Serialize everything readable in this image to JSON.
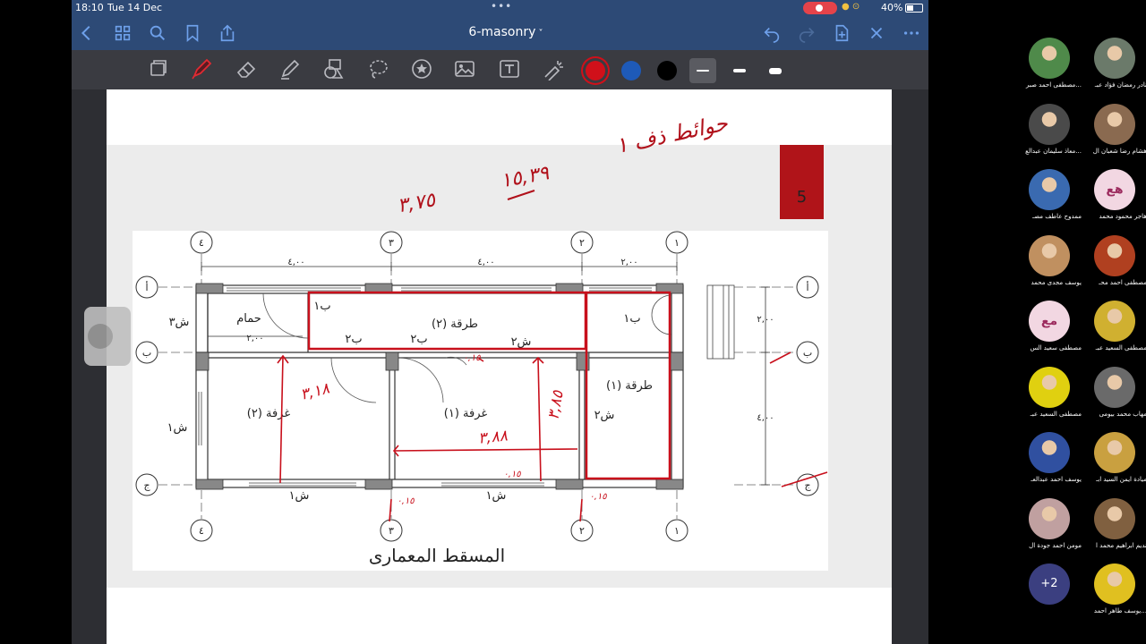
{
  "status": {
    "time": "18:10",
    "date": "Tue 14 Dec",
    "battery": "40%"
  },
  "document": {
    "title": "6-masonry",
    "page_number": "5"
  },
  "toolbar": {
    "pen_colors": [
      "#d0101a",
      "#1e5ab8",
      "#000000"
    ],
    "selected_color": "#d0101a"
  },
  "plan": {
    "caption": "المسقط المعمارى",
    "axis_numbers": [
      "٤",
      "٣",
      "٢",
      "١"
    ],
    "axis_letters": [
      "أ",
      "ب",
      "ج"
    ],
    "dims_top": [
      "٤,٠٠",
      "٤,٠٠",
      "٢,٠٠"
    ],
    "dims_right": [
      "٢,٠٠",
      "٤,٠٠"
    ],
    "bath_dim": "٢,٠٠",
    "rooms": {
      "bath": "حمام",
      "corridor2": "طرقة (٢)",
      "corridor1": "طرقة (١)",
      "room2": "غرفة (٢)",
      "room1": "غرفة (١)"
    },
    "labels": {
      "sh3": "ش٣",
      "sh1_left": "ش١",
      "sh2_right": "ش٢",
      "sh2_top": "ش٢",
      "sh1_bottom_a": "ش١",
      "sh1_bottom_b": "ش١",
      "b1_top": "ب١",
      "b1_right": "ب١",
      "b2_a": "ب٢",
      "b2_b": "ب٢"
    }
  },
  "annotations": {
    "heading": "حوائط ذف ١",
    "num1": "١٥,٣٩",
    "num2": "٣,٧٥",
    "r2_height": "٣,١٨",
    "r1_height": "٣,٨٥",
    "r1_width": "٣,٨٨",
    "small_a": "٠,١٥",
    "small_b": "٠,١٥",
    "small_c": "٠,١٥",
    "small_d": "٠,١٥"
  },
  "participants": [
    {
      "name": "نادر رمضان فؤاد عبـ",
      "kind": "photo",
      "color": "#6b7a6a"
    },
    {
      "name": "مصطفى احمد صبر...",
      "kind": "photo",
      "color": "#4f8a4a"
    },
    {
      "name": "هشام رضا شعبان ال",
      "kind": "photo",
      "color": "#8a6a50"
    },
    {
      "name": "معاذ سليمان عبدالع...",
      "kind": "photo",
      "color": "#4a4a4a"
    },
    {
      "name": "هاجر محمود محمد",
      "kind": "initials",
      "initials": "هع"
    },
    {
      "name": "ممدوح عاطف مصـ",
      "kind": "photo",
      "color": "#3a6ab0"
    },
    {
      "name": "مصطفى احمد محـ",
      "kind": "photo",
      "color": "#b04020"
    },
    {
      "name": "يوسف مجدى محمد",
      "kind": "photo",
      "color": "#c09060"
    },
    {
      "name": "مصطفى السعيد عبـ",
      "kind": "photo",
      "color": "#d0b030"
    },
    {
      "name": "مصطفى سعيد الس",
      "kind": "initials",
      "initials": "مع"
    },
    {
      "name": "مهاب محمد بيومى",
      "kind": "photo",
      "color": "#6a6a6a"
    },
    {
      "name": "مصطفى السعيد عبـ",
      "kind": "photo",
      "color": "#e0d010"
    },
    {
      "name": "ميادة ايمن السيد ابـ",
      "kind": "photo",
      "color": "#c9a040"
    },
    {
      "name": "يوسف احمد عبدالعـ",
      "kind": "photo",
      "color": "#3050a0"
    },
    {
      "name": "نديم ابراهيم محمد ا",
      "kind": "photo",
      "color": "#806040"
    },
    {
      "name": "مومن احمد جودة ال",
      "kind": "photo",
      "color": "#c0a0a0"
    },
    {
      "name": "يوسف طاهر احمد...",
      "kind": "photo",
      "color": "#e0c020"
    },
    {
      "name": "",
      "kind": "more",
      "label": "+2"
    }
  ]
}
